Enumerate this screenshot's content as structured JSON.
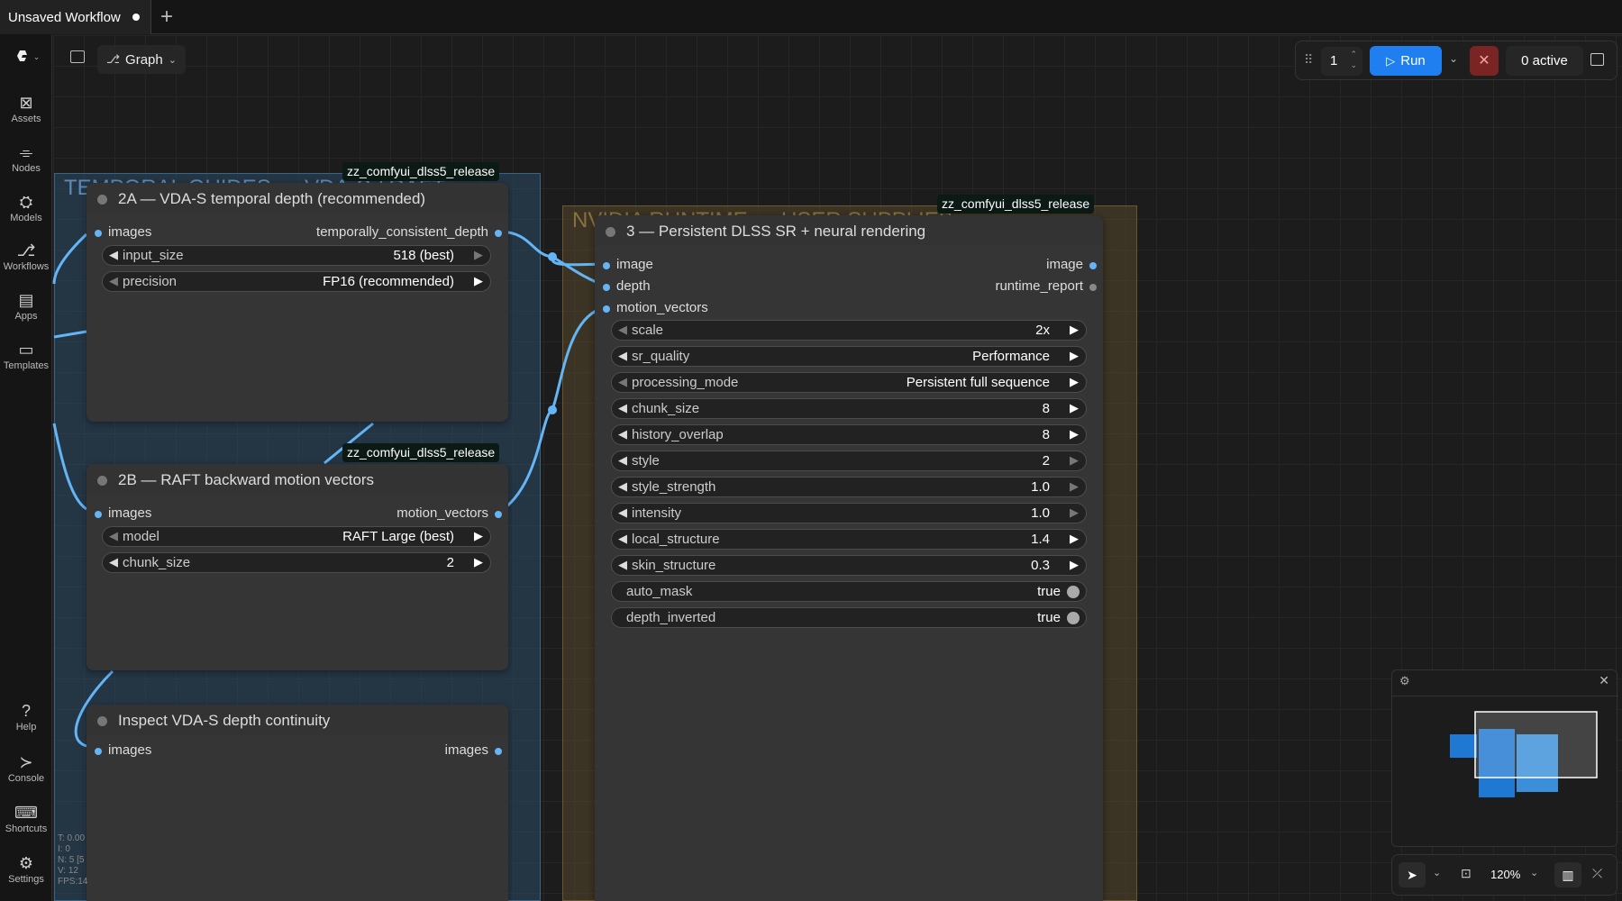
{
  "tabs": {
    "workflow_title": "Unsaved Workflow",
    "add_symbol": "+"
  },
  "sidebar": {
    "items": [
      {
        "label": "Assets",
        "icon": "assets-icon",
        "glyph": "⊠"
      },
      {
        "label": "Nodes",
        "icon": "nodes-icon",
        "glyph": "⌯"
      },
      {
        "label": "Models",
        "icon": "models-icon",
        "glyph": "⛭"
      },
      {
        "label": "Workflows",
        "icon": "workflows-icon",
        "glyph": "⎇"
      },
      {
        "label": "Apps",
        "icon": "apps-icon",
        "glyph": "▤"
      },
      {
        "label": "Templates",
        "icon": "templates-icon",
        "glyph": "▭"
      }
    ],
    "bottom_items": [
      {
        "label": "Help",
        "icon": "help-icon",
        "glyph": "?"
      },
      {
        "label": "Console",
        "icon": "console-icon",
        "glyph": "≻"
      },
      {
        "label": "Shortcuts",
        "icon": "keyboard-icon",
        "glyph": "⌨"
      },
      {
        "label": "Settings",
        "icon": "gear-icon",
        "glyph": "⚙"
      }
    ]
  },
  "header": {
    "view_label": "Graph"
  },
  "toolbar": {
    "queue_count": "1",
    "run_label": "Run",
    "stop_symbol": "✕",
    "active_label": "0 active"
  },
  "groups": {
    "temporal": {
      "title": "TEMPORAL GUIDES — VDA-S / RAFT",
      "color": "#2c4a66"
    },
    "runtime": {
      "title": "NVIDIA RUNTIME — USER SUPPLIED DLL",
      "color": "#5a4a2a"
    }
  },
  "nodes": {
    "vda": {
      "badge": "zz_comfyui_dlss5_release",
      "title": "2A — VDA-S temporal depth (recommended)",
      "inputs": [
        "images"
      ],
      "outputs": [
        "temporally_consistent_depth"
      ],
      "widgets": [
        {
          "name": "input_size",
          "value": "518 (best)"
        },
        {
          "name": "precision",
          "value": "FP16 (recommended)"
        }
      ]
    },
    "raft": {
      "badge": "zz_comfyui_dlss5_release",
      "title": "2B — RAFT backward motion vectors",
      "inputs": [
        "images"
      ],
      "outputs": [
        "motion_vectors"
      ],
      "widgets": [
        {
          "name": "model",
          "value": "RAFT Large (best)"
        },
        {
          "name": "chunk_size",
          "value": "2"
        }
      ]
    },
    "inspect": {
      "title": "Inspect VDA-S depth continuity",
      "inputs": [
        "images"
      ],
      "outputs": [
        "images"
      ]
    },
    "dlss": {
      "badge": "zz_comfyui_dlss5_release",
      "title": "3 — Persistent DLSS SR + neural rendering",
      "inputs": [
        "image",
        "depth",
        "motion_vectors"
      ],
      "outputs": [
        "image",
        "runtime_report"
      ],
      "widgets": [
        {
          "name": "scale",
          "value": "2x"
        },
        {
          "name": "sr_quality",
          "value": "Performance"
        },
        {
          "name": "processing_mode",
          "value": "Persistent full sequence"
        },
        {
          "name": "chunk_size",
          "value": "8"
        },
        {
          "name": "history_overlap",
          "value": "8"
        },
        {
          "name": "style",
          "value": "2"
        },
        {
          "name": "style_strength",
          "value": "1.0"
        },
        {
          "name": "intensity",
          "value": "1.0"
        },
        {
          "name": "local_structure",
          "value": "1.4"
        },
        {
          "name": "skin_structure",
          "value": "0.3"
        }
      ],
      "toggles": [
        {
          "name": "auto_mask",
          "value": "true"
        },
        {
          "name": "depth_inverted",
          "value": "true"
        }
      ]
    }
  },
  "stats": {
    "t": "T: 0.00",
    "i": "I: 0",
    "n": "N: 5 [5",
    "v": "V: 12",
    "fps": "FPS:14"
  },
  "bottombar": {
    "zoom": "120%"
  },
  "colors": {
    "link": "#64b5f6",
    "run": "#1f7ff0",
    "stop": "#7a2424",
    "accent_badge": "#0b1a14"
  }
}
